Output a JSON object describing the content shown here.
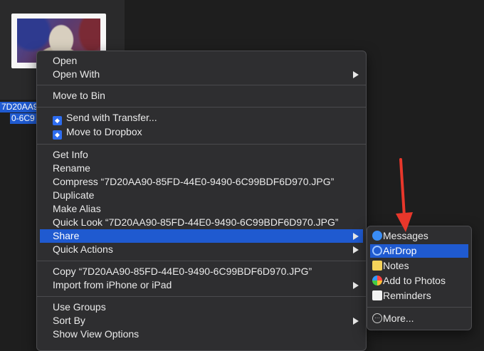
{
  "file": {
    "name_line1": "7D20AA9",
    "name_line2": "0-6C9"
  },
  "context_menu": {
    "groups": [
      [
        "Open",
        "Open With"
      ],
      [
        "Move to Bin"
      ],
      [
        "Send with Transfer...",
        "Move to Dropbox"
      ],
      [
        "Get Info",
        "Rename",
        "Compress “7D20AA90-85FD-44E0-9490-6C99BDF6D970.JPG”",
        "Duplicate",
        "Make Alias",
        "Quick Look “7D20AA90-85FD-44E0-9490-6C99BDF6D970.JPG”",
        "Share",
        "Quick Actions"
      ],
      [
        "Copy “7D20AA90-85FD-44E0-9490-6C99BDF6D970.JPG”",
        "Import from iPhone or iPad"
      ],
      [
        "Use Groups",
        "Sort By",
        "Show View Options"
      ]
    ],
    "open": "Open",
    "open_with": "Open With",
    "move_to_bin": "Move to Bin",
    "send_with_transfer": "Send with Transfer...",
    "move_to_dropbox": "Move to Dropbox",
    "get_info": "Get Info",
    "rename": "Rename",
    "compress": "Compress “7D20AA90-85FD-44E0-9490-6C99BDF6D970.JPG”",
    "duplicate": "Duplicate",
    "make_alias": "Make Alias",
    "quick_look": "Quick Look “7D20AA90-85FD-44E0-9490-6C99BDF6D970.JPG”",
    "share": "Share",
    "quick_actions": "Quick Actions",
    "copy": "Copy “7D20AA90-85FD-44E0-9490-6C99BDF6D970.JPG”",
    "import_iphone": "Import from iPhone or iPad",
    "use_groups": "Use Groups",
    "sort_by": "Sort By",
    "show_view_options": "Show View Options",
    "highlighted": "Share"
  },
  "share_submenu": {
    "messages": "Messages",
    "airdrop": "AirDrop",
    "notes": "Notes",
    "add_to_photos": "Add to Photos",
    "reminders": "Reminders",
    "more": "More...",
    "highlighted": "AirDrop"
  },
  "colors": {
    "highlight": "#1f5ad0",
    "menu_bg": "#2e2e30",
    "arrow": "#e8372b"
  }
}
